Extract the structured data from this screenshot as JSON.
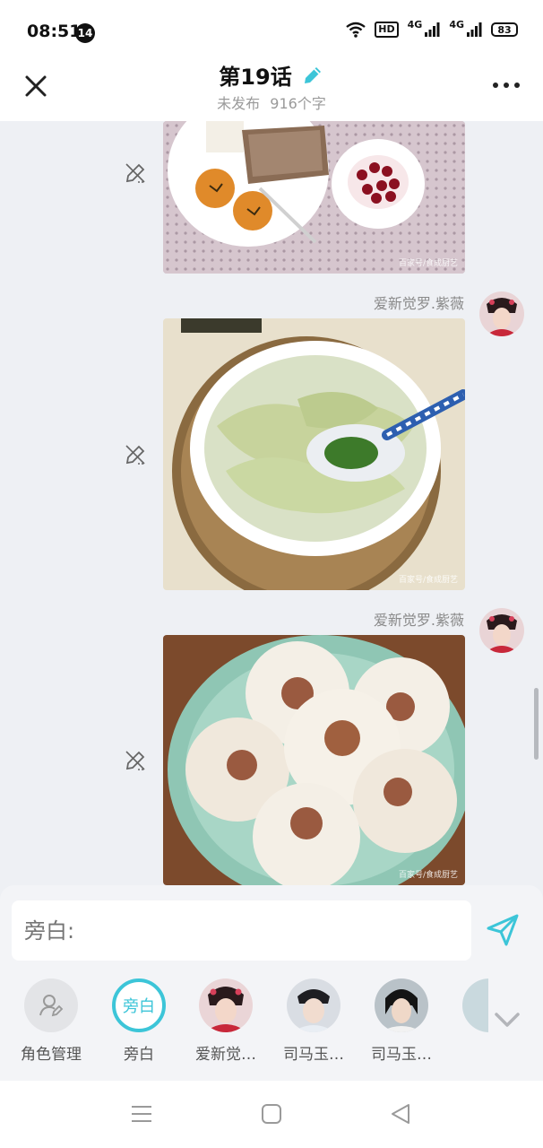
{
  "status_bar": {
    "time": "08:51",
    "notification_count": "14",
    "hd_label": "HD",
    "network_1": "4G",
    "network_2": "4G",
    "battery": "83"
  },
  "header": {
    "title": "第19话",
    "status": "未发布",
    "word_count": "916个字"
  },
  "messages": [
    {
      "type": "image",
      "depicts": "breakfast-plate",
      "watermark": "百家号/食成厨艺"
    },
    {
      "type": "image",
      "sender": "爱新觉罗.紫薇",
      "depicts": "wonton-soup",
      "watermark": "百家号/食成厨艺"
    },
    {
      "type": "image",
      "sender": "爱新觉罗.紫薇",
      "depicts": "steamed-buns",
      "watermark": "百家号/食成厨艺"
    }
  ],
  "composer": {
    "placeholder": "旁白:"
  },
  "roles": [
    {
      "label": "角色管理",
      "icon": "person-edit-icon"
    },
    {
      "label": "旁白",
      "circle_text": "旁白",
      "active": true
    },
    {
      "label": "爱新觉…"
    },
    {
      "label": "司马玉…"
    },
    {
      "label": "司马玉…"
    }
  ],
  "colors": {
    "accent": "#3cc5d8",
    "background": "#eef0f4",
    "panel": "#f3f4f7"
  }
}
